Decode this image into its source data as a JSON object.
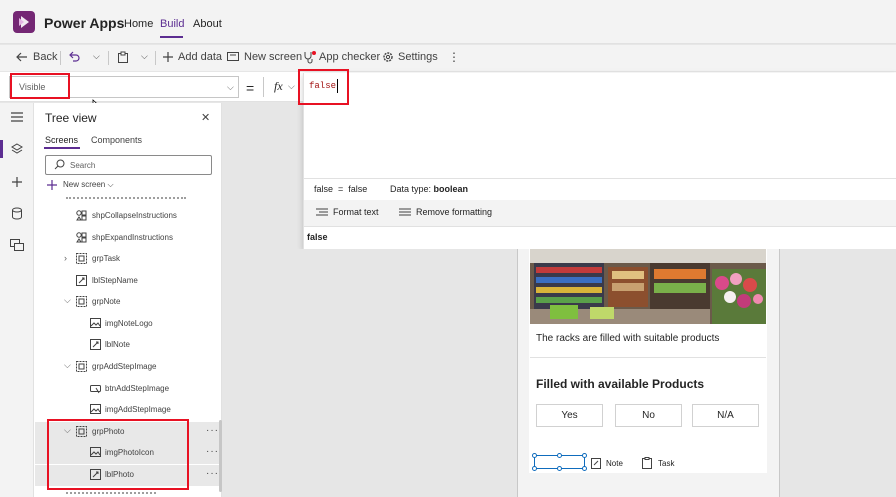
{
  "header": {
    "app_title": "Power Apps",
    "nav": [
      "Home",
      "Build",
      "About"
    ],
    "brand_color": "#742774",
    "accent_color": "#5c2d91"
  },
  "commandbar": {
    "back": "Back",
    "add_data": "Add data",
    "new_screen": "New screen",
    "app_checker": "App checker",
    "settings": "Settings"
  },
  "formula_bar": {
    "property": "Visible",
    "equals": "=",
    "fx": "fx",
    "formula": "false"
  },
  "formula_editor": {
    "eval_result": "false  =  false",
    "data_type_label": "Data type:",
    "data_type_value": "boolean",
    "format_text": "Format text",
    "remove_formatting": "Remove formatting",
    "preview_value": "false"
  },
  "tree_view": {
    "title": "Tree view",
    "tabs": [
      "Screens",
      "Components"
    ],
    "search_placeholder": "Search",
    "new_screen": "New screen",
    "items": [
      {
        "label": "shpCollapseInstructions",
        "icon": "shape-icon"
      },
      {
        "label": "shpExpandInstructions",
        "icon": "shape-icon"
      },
      {
        "label": "grpTask",
        "icon": "group-icon"
      },
      {
        "label": "lblStepName",
        "icon": "label-icon"
      },
      {
        "label": "grpNote",
        "icon": "group-icon"
      },
      {
        "label": "imgNoteLogo",
        "icon": "image-icon"
      },
      {
        "label": "lblNote",
        "icon": "label-icon"
      },
      {
        "label": "grpAddStepImage",
        "icon": "group-icon"
      },
      {
        "label": "btnAddStepImage",
        "icon": "button-icon"
      },
      {
        "label": "imgAddStepImage",
        "icon": "image-icon"
      },
      {
        "label": "grpPhoto",
        "icon": "group-icon"
      },
      {
        "label": "imgPhotoIcon",
        "icon": "image-icon"
      },
      {
        "label": "lblPhoto",
        "icon": "label-icon"
      }
    ]
  },
  "canvas": {
    "caption": "The racks are filled with suitable products",
    "heading": "Filled with available Products",
    "choices": [
      "Yes",
      "No",
      "N/A"
    ],
    "note": "Note",
    "task": "Task"
  },
  "highlight_color": "#e81123"
}
